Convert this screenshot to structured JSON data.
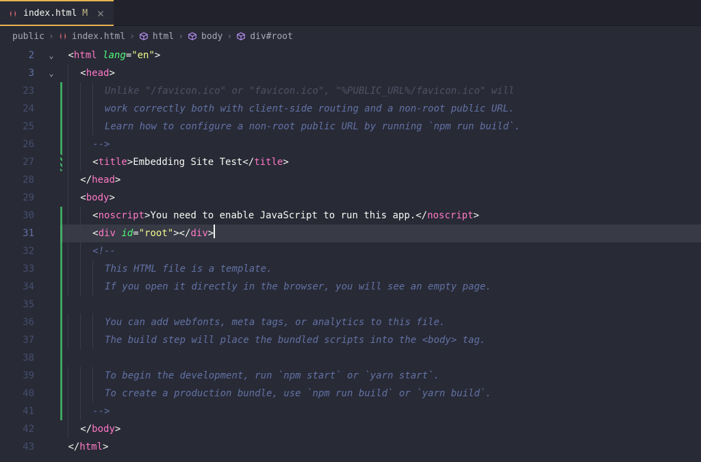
{
  "tab": {
    "filename": "index.html",
    "modified_marker": "M"
  },
  "breadcrumbs": {
    "items": [
      {
        "label": "public",
        "icon": null
      },
      {
        "label": "index.html",
        "icon": "html"
      },
      {
        "label": "html",
        "icon": "element"
      },
      {
        "label": "body",
        "icon": "element"
      },
      {
        "label": "div#root",
        "icon": "element"
      }
    ]
  },
  "code": {
    "lines": [
      {
        "num": "2",
        "faded": false,
        "fold": "open",
        "indent": 0,
        "diff": null,
        "tokens": [
          {
            "t": "bracket",
            "v": "<"
          },
          {
            "t": "tag",
            "v": "html"
          },
          {
            "t": "text",
            "v": " "
          },
          {
            "t": "attr",
            "v": "lang"
          },
          {
            "t": "bracket",
            "v": "="
          },
          {
            "t": "string",
            "v": "\"en\""
          },
          {
            "t": "bracket",
            "v": ">"
          }
        ]
      },
      {
        "num": "3",
        "faded": false,
        "fold": "open",
        "indent": 1,
        "diff": null,
        "tokens": [
          {
            "t": "bracket",
            "v": "<"
          },
          {
            "t": "tag",
            "v": "head"
          },
          {
            "t": "bracket",
            "v": ">"
          }
        ]
      },
      {
        "num": "23",
        "faded": true,
        "fold": null,
        "indent": 3,
        "diff": "green",
        "tokens": [
          {
            "t": "comment-faded",
            "v": "Unlike \"/favicon.ico\" or \"favicon.ico\", \"%PUBLIC_URL%/favicon.ico\" will"
          }
        ]
      },
      {
        "num": "24",
        "faded": true,
        "fold": null,
        "indent": 3,
        "diff": "green",
        "tokens": [
          {
            "t": "comment",
            "v": "work correctly both with client-side routing and a non-root public URL."
          }
        ]
      },
      {
        "num": "25",
        "faded": true,
        "fold": null,
        "indent": 3,
        "diff": "green",
        "tokens": [
          {
            "t": "comment",
            "v": "Learn how to configure a non-root public URL by running `npm run build`."
          }
        ]
      },
      {
        "num": "26",
        "faded": true,
        "fold": null,
        "indent": 2,
        "diff": "green",
        "tokens": [
          {
            "t": "comment",
            "v": "-->"
          }
        ]
      },
      {
        "num": "27",
        "faded": true,
        "fold": null,
        "indent": 2,
        "diff": "stripe",
        "tokens": [
          {
            "t": "bracket",
            "v": "<"
          },
          {
            "t": "tag",
            "v": "title"
          },
          {
            "t": "bracket",
            "v": ">"
          },
          {
            "t": "text",
            "v": "Embedding Site Test"
          },
          {
            "t": "bracket",
            "v": "</"
          },
          {
            "t": "tag",
            "v": "title"
          },
          {
            "t": "bracket",
            "v": ">"
          }
        ]
      },
      {
        "num": "28",
        "faded": true,
        "fold": null,
        "indent": 1,
        "diff": null,
        "tokens": [
          {
            "t": "bracket",
            "v": "</"
          },
          {
            "t": "tag",
            "v": "head"
          },
          {
            "t": "bracket",
            "v": ">"
          }
        ]
      },
      {
        "num": "29",
        "faded": true,
        "fold": null,
        "indent": 1,
        "diff": null,
        "tokens": [
          {
            "t": "bracket",
            "v": "<"
          },
          {
            "t": "tag",
            "v": "body"
          },
          {
            "t": "bracket",
            "v": ">"
          }
        ]
      },
      {
        "num": "30",
        "faded": true,
        "fold": null,
        "indent": 2,
        "diff": "green",
        "tokens": [
          {
            "t": "bracket",
            "v": "<"
          },
          {
            "t": "tag",
            "v": "noscript"
          },
          {
            "t": "bracket",
            "v": ">"
          },
          {
            "t": "text",
            "v": "You need to enable JavaScript to run this app."
          },
          {
            "t": "bracket",
            "v": "</"
          },
          {
            "t": "tag",
            "v": "noscript"
          },
          {
            "t": "bracket",
            "v": ">"
          }
        ]
      },
      {
        "num": "31",
        "faded": false,
        "fold": null,
        "indent": 2,
        "diff": "green",
        "active": true,
        "cursor": true,
        "tokens": [
          {
            "t": "bracket",
            "v": "<"
          },
          {
            "t": "tag",
            "v": "div"
          },
          {
            "t": "text",
            "v": " "
          },
          {
            "t": "attr",
            "v": "id"
          },
          {
            "t": "bracket",
            "v": "="
          },
          {
            "t": "string",
            "v": "\"root\""
          },
          {
            "t": "bracket",
            "v": "></"
          },
          {
            "t": "tag",
            "v": "div"
          },
          {
            "t": "bracket",
            "v": ">"
          }
        ]
      },
      {
        "num": "32",
        "faded": true,
        "fold": null,
        "indent": 2,
        "diff": "green",
        "tokens": [
          {
            "t": "comment",
            "v": "<!--"
          }
        ]
      },
      {
        "num": "33",
        "faded": true,
        "fold": null,
        "indent": 3,
        "diff": "green",
        "tokens": [
          {
            "t": "comment",
            "v": "This HTML file is a template."
          }
        ]
      },
      {
        "num": "34",
        "faded": true,
        "fold": null,
        "indent": 3,
        "diff": "green",
        "tokens": [
          {
            "t": "comment",
            "v": "If you open it directly in the browser, you will see an empty page."
          }
        ]
      },
      {
        "num": "35",
        "faded": true,
        "fold": null,
        "indent": 0,
        "diff": "green",
        "tokens": []
      },
      {
        "num": "36",
        "faded": true,
        "fold": null,
        "indent": 3,
        "diff": "green",
        "tokens": [
          {
            "t": "comment",
            "v": "You can add webfonts, meta tags, or analytics to this file."
          }
        ]
      },
      {
        "num": "37",
        "faded": true,
        "fold": null,
        "indent": 3,
        "diff": "green",
        "tokens": [
          {
            "t": "comment",
            "v": "The build step will place the bundled scripts into the <body> tag."
          }
        ]
      },
      {
        "num": "38",
        "faded": true,
        "fold": null,
        "indent": 0,
        "diff": "green",
        "tokens": []
      },
      {
        "num": "39",
        "faded": true,
        "fold": null,
        "indent": 3,
        "diff": "green",
        "tokens": [
          {
            "t": "comment",
            "v": "To begin the development, run `npm start` or `yarn start`."
          }
        ]
      },
      {
        "num": "40",
        "faded": true,
        "fold": null,
        "indent": 3,
        "diff": "green",
        "tokens": [
          {
            "t": "comment",
            "v": "To create a production bundle, use `npm run build` or `yarn build`."
          }
        ]
      },
      {
        "num": "41",
        "faded": true,
        "fold": null,
        "indent": 2,
        "diff": "green",
        "tokens": [
          {
            "t": "comment",
            "v": "-->"
          }
        ]
      },
      {
        "num": "42",
        "faded": true,
        "fold": null,
        "indent": 1,
        "diff": null,
        "tokens": [
          {
            "t": "bracket",
            "v": "</"
          },
          {
            "t": "tag",
            "v": "body"
          },
          {
            "t": "bracket",
            "v": ">"
          }
        ]
      },
      {
        "num": "43",
        "faded": true,
        "fold": null,
        "indent": 0,
        "diff": null,
        "tokens": [
          {
            "t": "bracket",
            "v": "</"
          },
          {
            "t": "tag",
            "v": "html"
          },
          {
            "t": "bracket",
            "v": ">"
          }
        ]
      }
    ]
  }
}
